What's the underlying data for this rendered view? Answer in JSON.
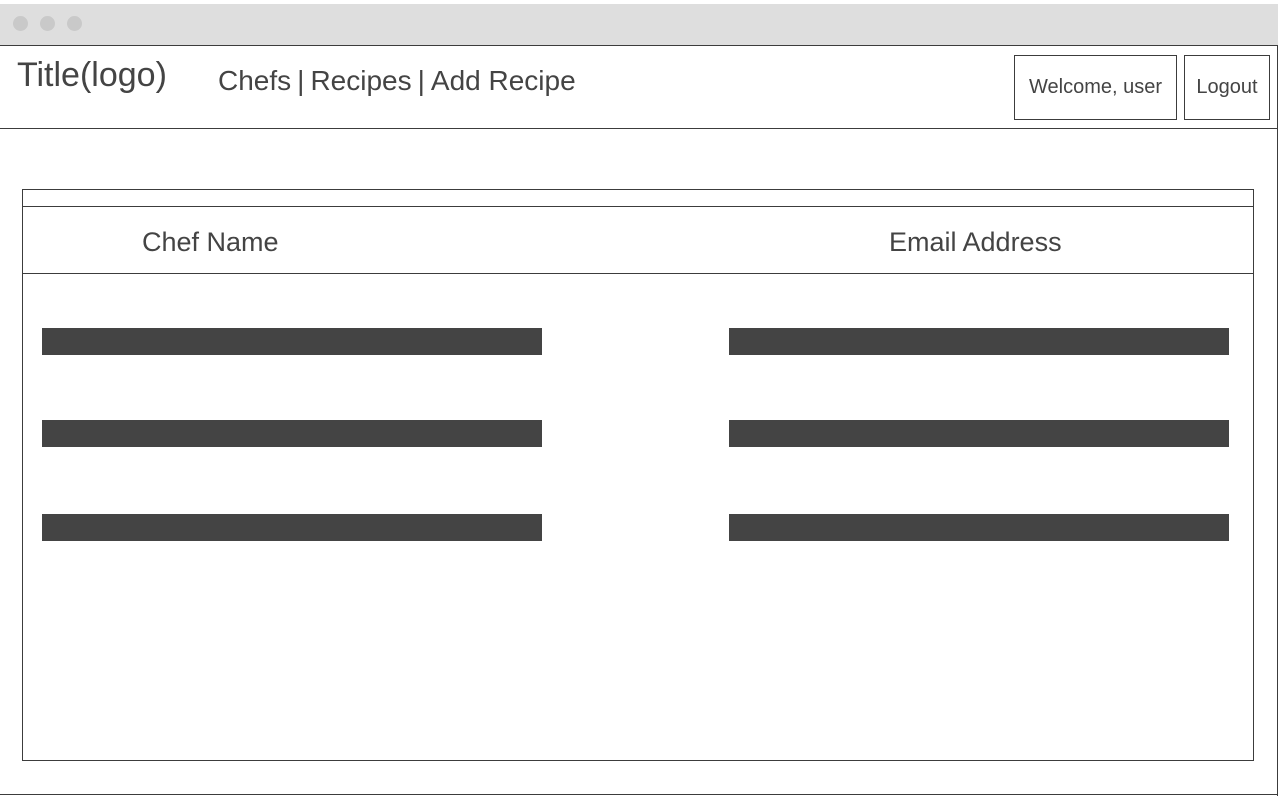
{
  "header": {
    "logo": "Title(logo)",
    "nav": [
      {
        "label": "Chefs"
      },
      {
        "label": "Recipes"
      },
      {
        "label": "Add Recipe"
      }
    ],
    "nav_separator": "|",
    "welcome": "Welcome, user",
    "logout_label": "Logout"
  },
  "table": {
    "columns": [
      "Chef Name",
      "Email Address"
    ],
    "rows": [
      {
        "name": "",
        "email": ""
      },
      {
        "name": "",
        "email": ""
      },
      {
        "name": "",
        "email": ""
      }
    ]
  },
  "colors": {
    "text": "#444444",
    "placeholder_bar": "#444444",
    "window_bar": "#dedede",
    "window_dot": "#c9c9c9",
    "border": "#3c3c3c"
  }
}
